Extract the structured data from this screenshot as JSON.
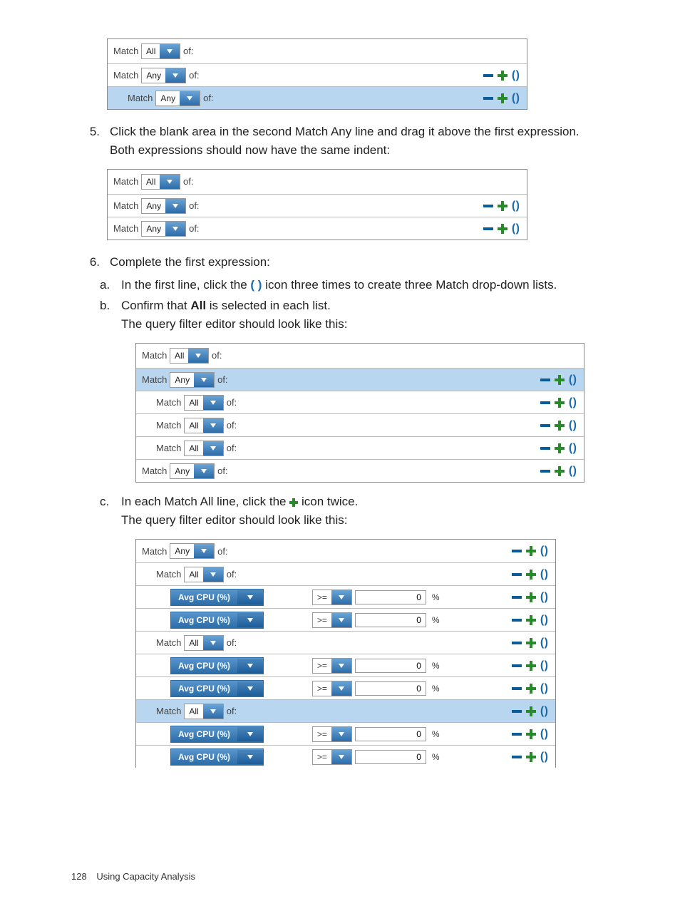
{
  "steps": {
    "s5": {
      "num": "5.",
      "text_a": "Click the blank area in the second Match Any line and drag it above the first expression.",
      "text_b": "Both expressions should now have the same indent:"
    },
    "s6": {
      "num": "6.",
      "text": "Complete the first expression:",
      "a": {
        "let": "a.",
        "pre": "In the first line, click the ",
        "post": " icon three times to create three Match drop-down lists."
      },
      "b": {
        "let": "b.",
        "l1_pre": "Confirm that ",
        "bold": "All",
        "l1_post": " is selected in each list.",
        "l2": "The query filter editor should look like this:"
      },
      "c": {
        "let": "c.",
        "l1_pre": "In each Match All line, click the ",
        "l1_post": " icon twice.",
        "l2": "The query filter editor should look like this:"
      }
    }
  },
  "ui": {
    "match": "Match",
    "of": "of:",
    "all": "All",
    "any": "Any",
    "metric": "Avg CPU (%)",
    "op": ">=",
    "val": "0",
    "unit": "%",
    "par": "( )"
  },
  "footer": {
    "page": "128",
    "section": "Using Capacity Analysis"
  }
}
